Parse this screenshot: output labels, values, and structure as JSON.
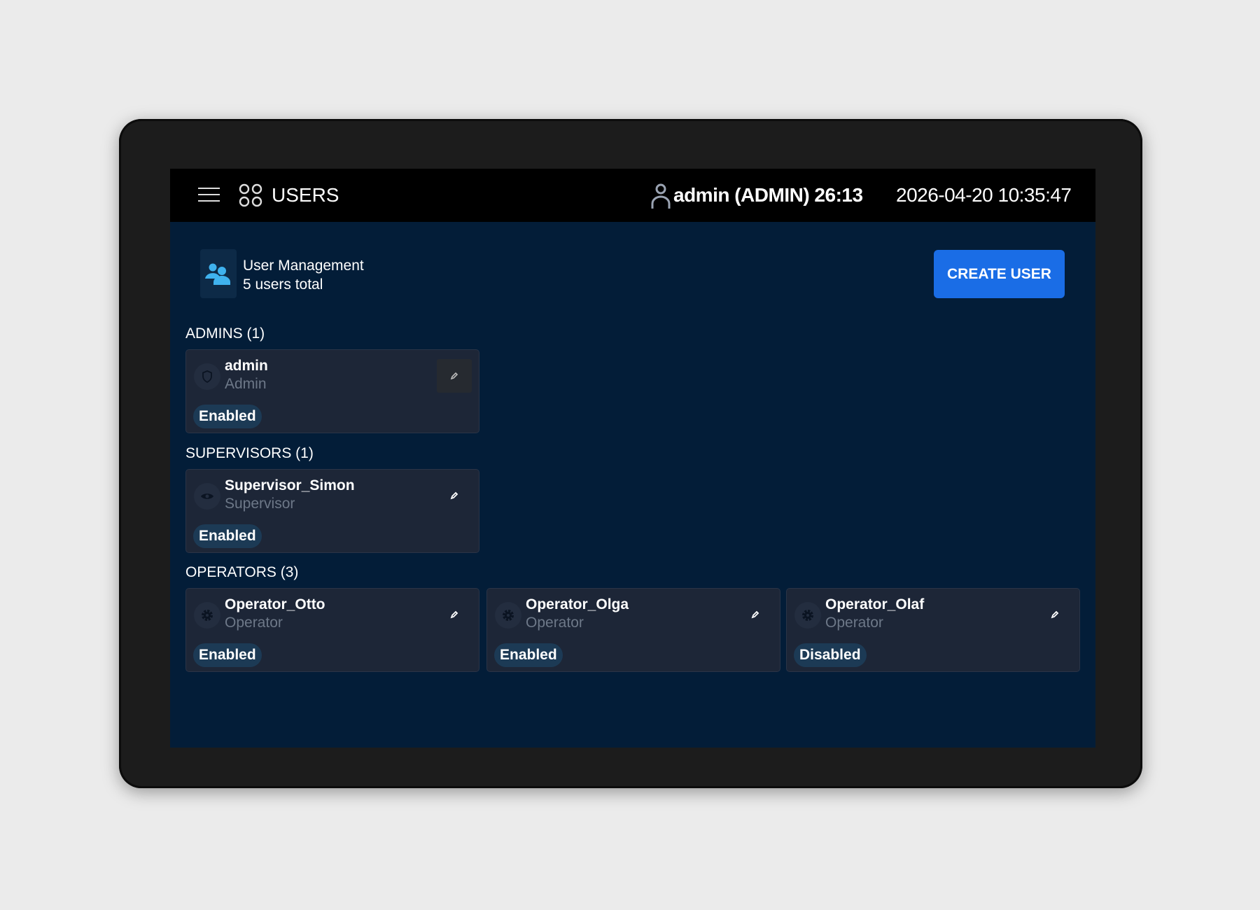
{
  "header": {
    "title": "USERS",
    "user_info": "admin (ADMIN) 26:13",
    "datetime": "2026-04-20 10:35:47"
  },
  "summary": {
    "title": "User Management",
    "subtitle": "5 users total",
    "create_label": "CREATE USER"
  },
  "sections": [
    {
      "label": "ADMINS (1)",
      "users": [
        {
          "name": "admin",
          "role": "Admin",
          "status": "Enabled",
          "icon": "shield-icon"
        }
      ]
    },
    {
      "label": "SUPERVISORS (1)",
      "users": [
        {
          "name": "Supervisor_Simon",
          "role": "Supervisor",
          "status": "Enabled",
          "icon": "eye-icon"
        }
      ]
    },
    {
      "label": "OPERATORS (3)",
      "users": [
        {
          "name": "Operator_Otto",
          "role": "Operator",
          "status": "Enabled",
          "icon": "gear-icon"
        },
        {
          "name": "Operator_Olga",
          "role": "Operator",
          "status": "Enabled",
          "icon": "gear-icon"
        },
        {
          "name": "Operator_Olaf",
          "role": "Operator",
          "status": "Disabled",
          "icon": "gear-icon"
        }
      ]
    }
  ],
  "colors": {
    "accent": "#1a6de6",
    "screen_bg": "#031d38",
    "card_bg": "#1d2637",
    "badge_bg": "#1c3a55"
  }
}
